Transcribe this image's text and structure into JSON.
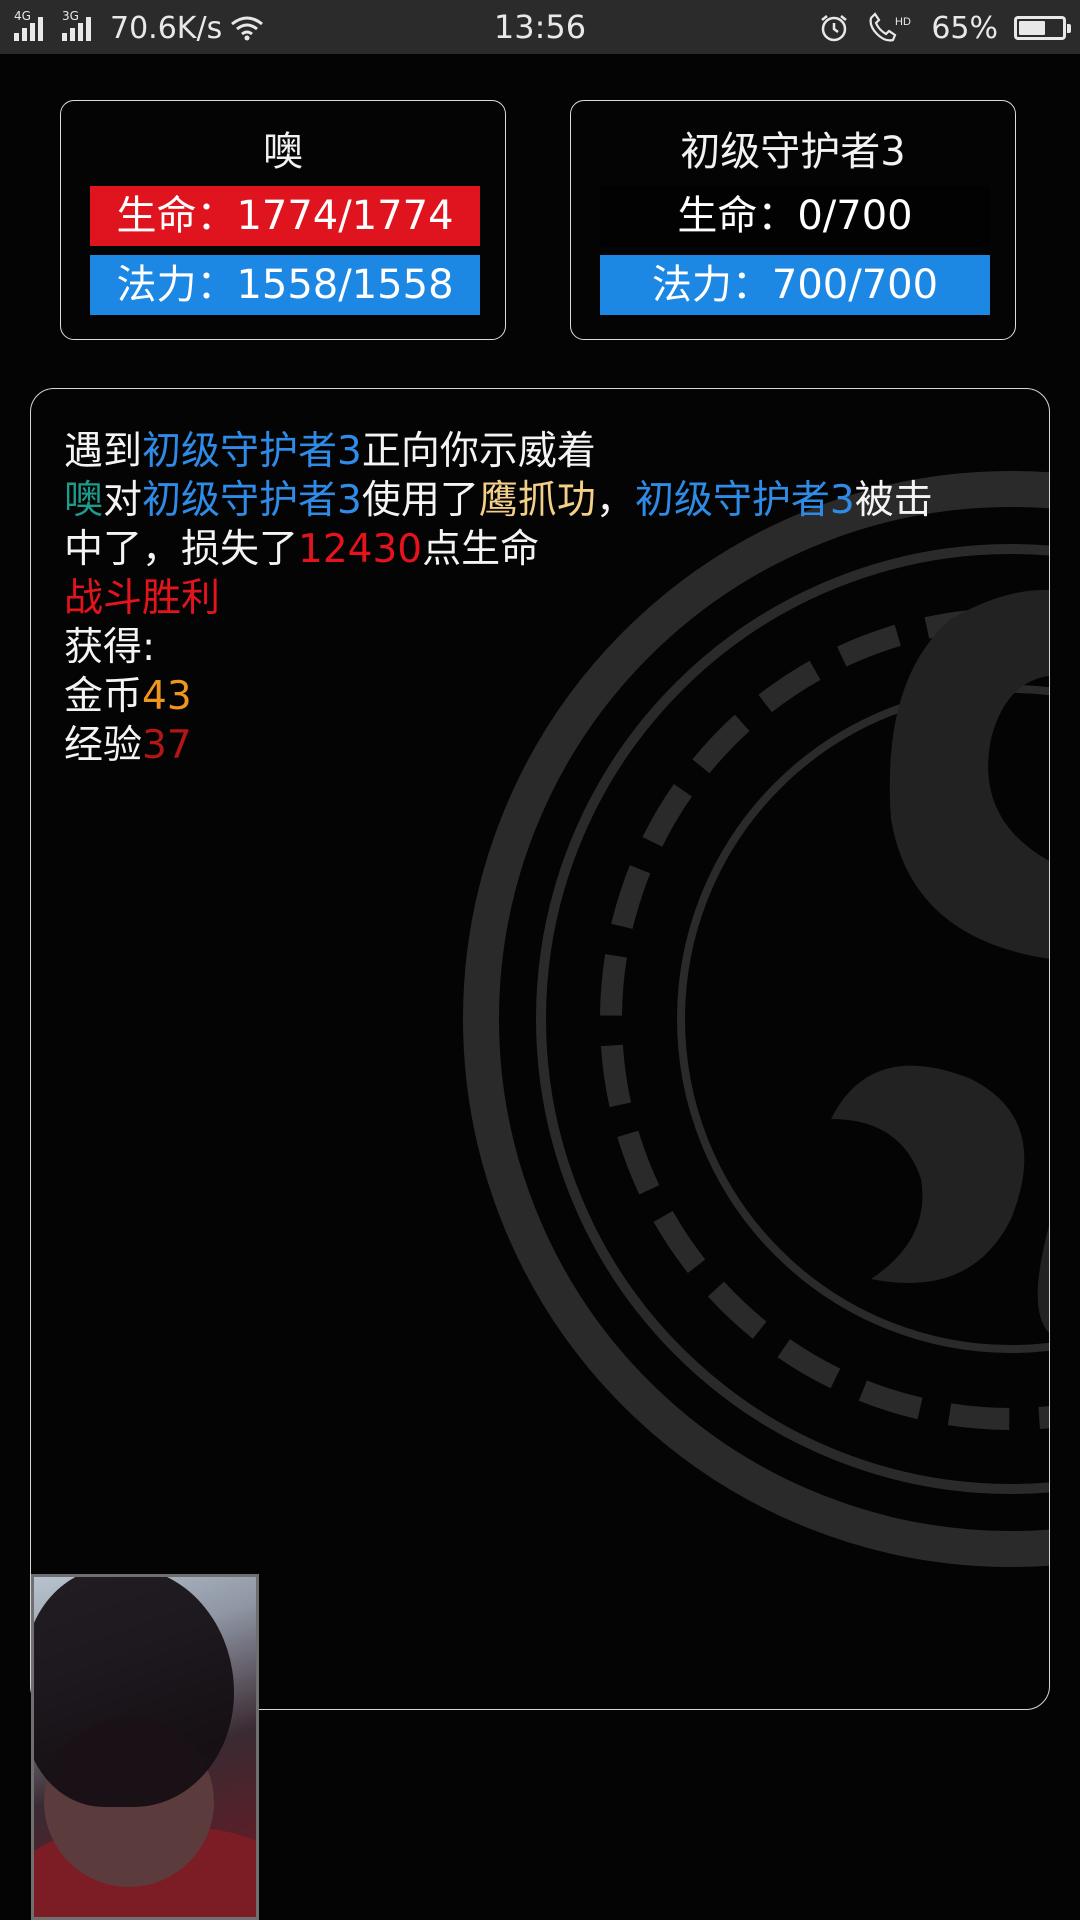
{
  "status_bar": {
    "network_1": "4G",
    "network_2": "3G",
    "speed": "70.6K/s",
    "time": "13:56",
    "battery": "65%",
    "battery_level": 0.65,
    "icons": [
      "signal-icon",
      "signal-icon",
      "wifi-icon",
      "alarm-icon",
      "hd-call-icon",
      "battery-icon"
    ]
  },
  "player": {
    "name": "噢",
    "hp_text": "生命：1774/1774",
    "mp_text": "法力：1558/1558",
    "hp_color": "#e0141e",
    "mp_color": "#1d87e4"
  },
  "enemy": {
    "name": "初级守护者3",
    "hp_text": "生命：0/700",
    "mp_text": "法力：700/700"
  },
  "log": {
    "line1": {
      "a": "遇到",
      "b": "初级守护者3",
      "c": "正向你示威着"
    },
    "line2": {
      "a": "噢",
      "b": "对",
      "c": "初级守护者3",
      "d": "使用了",
      "e": "鹰抓功",
      "f": "，",
      "g": "初级守护者3",
      "h": "被击"
    },
    "line3": {
      "a": "中了，损失了",
      "b": "12430",
      "c": "点生命"
    },
    "line4": "战斗胜利",
    "line5": "获得:",
    "line6": {
      "a": "金币",
      "b": "43"
    },
    "line7": {
      "a": "经验",
      "b": "37"
    }
  },
  "colors": {
    "enemy_name": "#2f8be6",
    "player_name": "#1e9b8a",
    "skill": "#f3cf88",
    "damage": "#e5141c",
    "gold": "#f0951e",
    "exp": "#b21616"
  }
}
